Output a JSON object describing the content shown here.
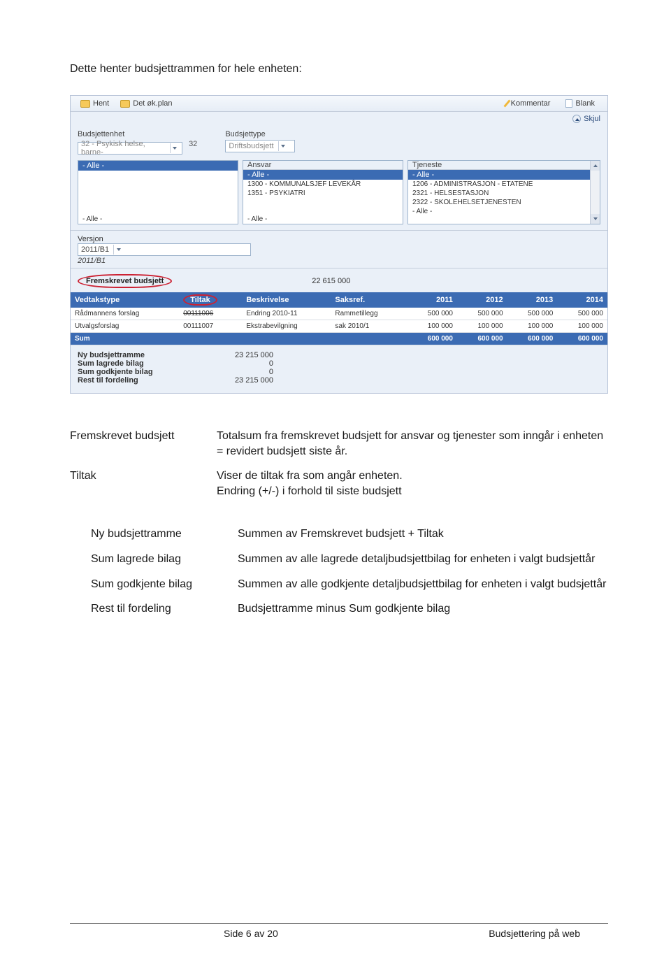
{
  "intro": "Dette henter budsjettrammen for hele enheten:",
  "toolbar": {
    "hent": "Hent",
    "detok": "Det øk.plan",
    "kommentar": "Kommentar",
    "blank": "Blank"
  },
  "skjul": "Skjul",
  "filters": {
    "budsjettenhet_label": "Budsjettenhet",
    "budsjettenhet_value": "32 - Psykisk helse, barne-",
    "budsjettenhet_code": "32",
    "budsjettype_label": "Budsjettype",
    "budsjettype_value": "Driftsbudsjett",
    "pane_left": {
      "top": "- Alle -",
      "bottom": "- Alle -"
    },
    "ansvar_label": "Ansvar",
    "ansvar": {
      "top": "- Alle -",
      "items": [
        "1300 - KOMMUNALSJEF LEVEKÅR",
        "1351 - PSYKIATRI"
      ],
      "bottom": "- Alle -"
    },
    "tjeneste_label": "Tjeneste",
    "tjeneste": {
      "top": "- Alle -",
      "items": [
        "1206 - ADMINISTRASJON - ETATENE",
        "2321 - HELSESTASJON",
        "2322 - SKOLEHELSETJENESTEN"
      ],
      "bottom": "- Alle -"
    }
  },
  "versjon": {
    "label": "Versjon",
    "value": "2011/B1",
    "ital": "2011/B1"
  },
  "fremskrevet": {
    "label": "Fremskrevet budsjett",
    "value": "22 615 000"
  },
  "grid": {
    "headers": [
      "Vedtakstype",
      "Tiltak",
      "Beskrivelse",
      "Saksref.",
      "2011",
      "2012",
      "2013",
      "2014"
    ],
    "rows": [
      {
        "c0": "Rådmannens forslag",
        "c1": "00111006",
        "c2": "Endring 2010-11",
        "c3": "Rammetillegg",
        "y1": "500 000",
        "y2": "500 000",
        "y3": "500 000",
        "y4": "500 000",
        "strike": true
      },
      {
        "c0": "Utvalgsforslag",
        "c1": "00111007",
        "c2": "Ekstrabevilgning",
        "c3": "sak 2010/1",
        "y1": "100 000",
        "y2": "100 000",
        "y3": "100 000",
        "y4": "100 000",
        "strike": false
      }
    ],
    "sum": {
      "label": "Sum",
      "y1": "600 000",
      "y2": "600 000",
      "y3": "600 000",
      "y4": "600 000"
    }
  },
  "summary": {
    "rows": [
      {
        "label": "Ny budsjettramme",
        "value": "23 215 000"
      },
      {
        "label": "Sum lagrede bilag",
        "value": "0"
      },
      {
        "label": "Sum godkjente bilag",
        "value": "0"
      },
      {
        "label": "Rest til fordeling",
        "value": "23 215 000"
      }
    ]
  },
  "defs1": [
    {
      "label": "Fremskrevet budsjett",
      "text": "Totalsum fra fremskrevet budsjett for ansvar og tjenester som inngår i enheten\n= revidert budsjett siste år."
    },
    {
      "label": "Tiltak",
      "text": "Viser de tiltak fra som angår enheten.\nEndring (+/-) i forhold til siste budsjett"
    }
  ],
  "defs2": [
    {
      "label": "Ny budsjettramme",
      "text": "Summen av Fremskrevet budsjett + Tiltak"
    },
    {
      "label": "Sum lagrede bilag",
      "text": "Summen av alle lagrede detaljbudsjettbilag for enheten i valgt budsjettår"
    },
    {
      "label": "Sum godkjente bilag",
      "text": "Summen av alle godkjente detaljbudsjettbilag for enheten i valgt budsjettår"
    },
    {
      "label": "Rest til fordeling",
      "text": "Budsjettramme minus Sum godkjente bilag"
    }
  ],
  "footer": {
    "page": "Side 6 av 20",
    "title": "Budsjettering på web"
  }
}
